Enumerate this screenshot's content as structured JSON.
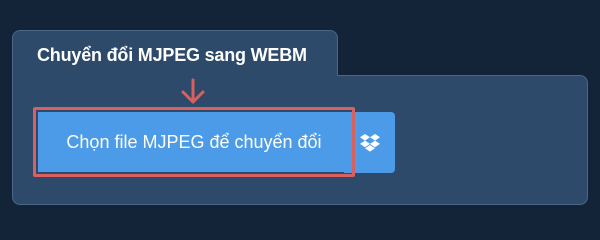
{
  "tab": {
    "title": "Chuyển đổi MJPEG sang WEBM"
  },
  "upload": {
    "button_label": "Chọn file MJPEG để chuyển đổi",
    "dropbox_icon": "dropbox-icon",
    "arrow_icon": "arrow-down-icon"
  },
  "colors": {
    "background": "#142438",
    "panel": "#2d4a6b",
    "button": "#4b9be8",
    "highlight": "#d9605c"
  }
}
